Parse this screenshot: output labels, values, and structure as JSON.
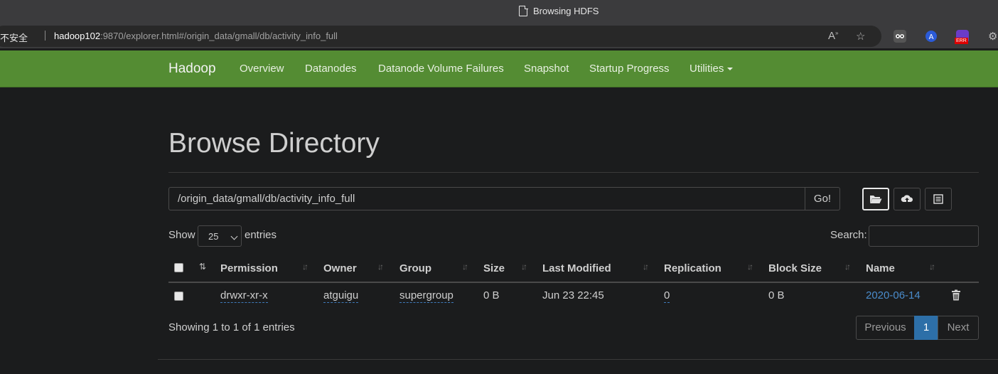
{
  "window": {
    "title": "Browsing HDFS"
  },
  "address_bar": {
    "security_label": "不安全",
    "url_host": "hadoop102",
    "url_rest": ":9870/explorer.html#/origin_data/gmall/db/activity_info_full",
    "extension_badge": "ERR"
  },
  "navbar": {
    "brand": "Hadoop",
    "items": [
      "Overview",
      "Datanodes",
      "Datanode Volume Failures",
      "Snapshot",
      "Startup Progress",
      "Utilities"
    ]
  },
  "page": {
    "title": "Browse Directory",
    "path_value": "/origin_data/gmall/db/activity_info_full",
    "go_label": "Go!"
  },
  "table_controls": {
    "show_label": "Show",
    "entries_value": "25",
    "entries_label": "entries",
    "search_label": "Search:"
  },
  "table": {
    "headers": [
      "Permission",
      "Owner",
      "Group",
      "Size",
      "Last Modified",
      "Replication",
      "Block Size",
      "Name"
    ],
    "rows": [
      {
        "permission": "drwxr-xr-x",
        "owner": "atguigu",
        "group": "supergroup",
        "size": "0 B",
        "last_modified": "Jun 23 22:45",
        "replication": "0",
        "block_size": "0 B",
        "name": "2020-06-14"
      }
    ]
  },
  "footer": {
    "info": "Showing 1 to 1 of 1 entries",
    "previous": "Previous",
    "page": "1",
    "next": "Next"
  },
  "colors": {
    "navbar": "#548c33",
    "background": "#1b1c1d",
    "link": "#4a8ccc",
    "active_page": "#2d6fa8"
  }
}
